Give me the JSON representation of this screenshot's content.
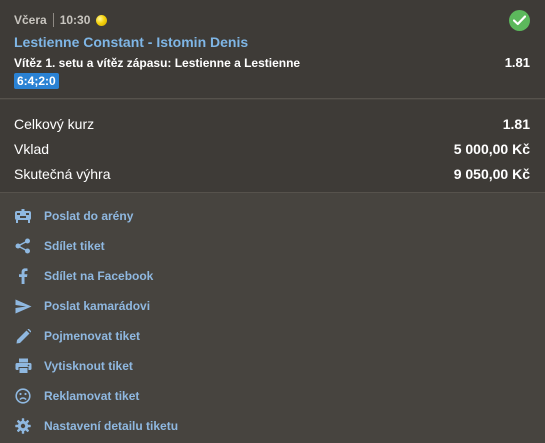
{
  "bet": {
    "day": "Včera",
    "time": "10:30",
    "match": "Lestienne Constant - Istomin Denis",
    "selection": "Vítěz 1. setu a vítěz zápasu: Lestienne a Lestienne",
    "odds": "1.81",
    "score": "6:4;2:0",
    "status": "won"
  },
  "summary": {
    "total_odds_label": "Celkový kurz",
    "total_odds_value": "1.81",
    "stake_label": "Vklad",
    "stake_value": "5 000,00 Kč",
    "payout_label": "Skutečná výhra",
    "payout_value": "9 050,00 Kč"
  },
  "actions": [
    {
      "label": "Poslat do arény",
      "icon": "arena-icon"
    },
    {
      "label": "Sdílet tiket",
      "icon": "share-icon"
    },
    {
      "label": "Sdílet na Facebook",
      "icon": "facebook-icon"
    },
    {
      "label": "Poslat kamarádovi",
      "icon": "send-icon"
    },
    {
      "label": "Pojmenovat tiket",
      "icon": "pencil-icon"
    },
    {
      "label": "Vytisknout tiket",
      "icon": "print-icon"
    },
    {
      "label": "Reklamovat tiket",
      "icon": "sad-face-icon"
    },
    {
      "label": "Nastavení detailu tiketu",
      "icon": "gear-icon"
    }
  ],
  "colors": {
    "background": "#47443f",
    "panel": "#3e3b37",
    "link": "#7fb6e6",
    "success": "#5cb85c",
    "badge": "#2a82d4"
  }
}
